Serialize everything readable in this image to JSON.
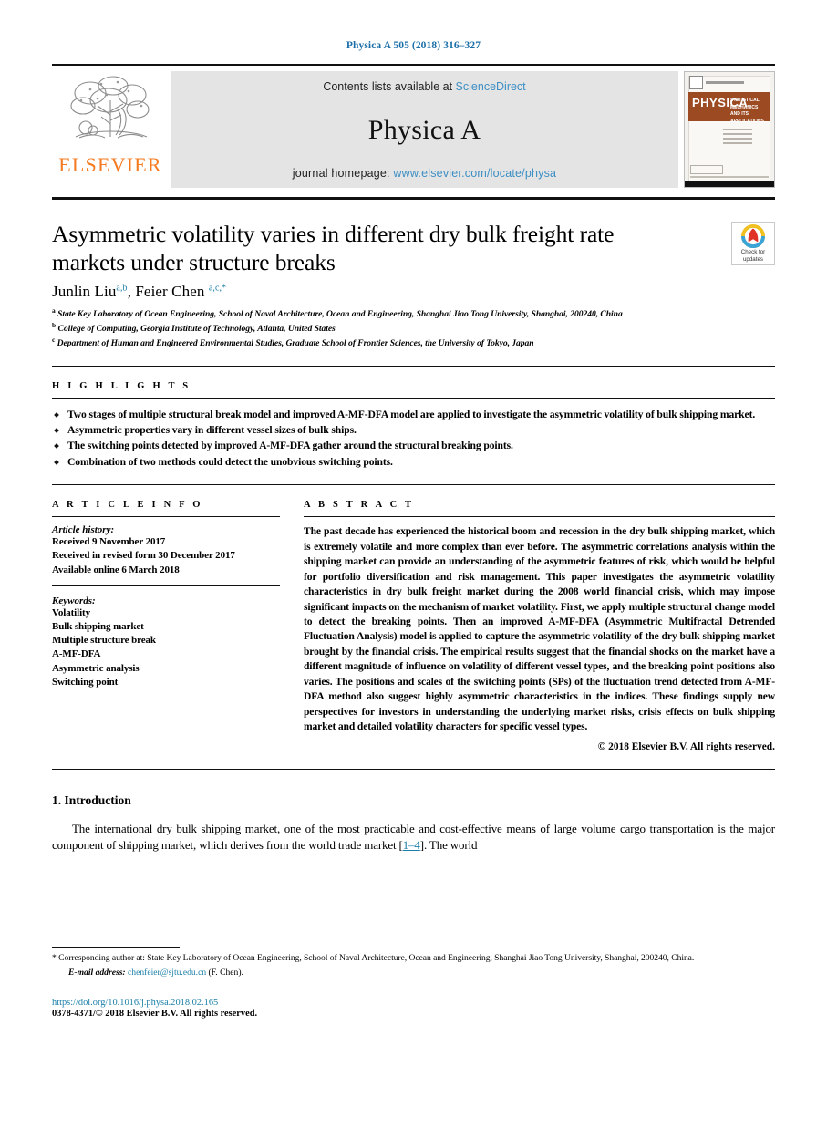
{
  "running_head": "Physica A 505 (2018) 316–327",
  "masthead": {
    "publisher_name": "ELSEVIER",
    "contents_prefix": "Contents lists available at",
    "contents_link": "ScienceDirect",
    "journal_title": "Physica A",
    "homepage_prefix": "journal homepage:",
    "homepage_link": "www.elsevier.com/locate/physa",
    "cover": {
      "wordmark": "PHYSICA",
      "subtitle": "STATISTICAL MECHANICS AND ITS APPLICATIONS"
    }
  },
  "article": {
    "title": "Asymmetric volatility varies in different dry bulk freight rate markets under structure breaks",
    "authors_plain": "Junlin Liu",
    "author1": "Junlin Liu",
    "author1_sup": "a,b",
    "author2": "Feier Chen",
    "author2_sup": "a,c,*",
    "affiliations": [
      {
        "marker": "a",
        "text": "State Key Laboratory of Ocean Engineering, School of Naval Architecture, Ocean and Engineering, Shanghai Jiao Tong University, Shanghai, 200240, China"
      },
      {
        "marker": "b",
        "text": "College of Computing, Georgia Institute of Technology, Atlanta, United States"
      },
      {
        "marker": "c",
        "text": "Department of Human and Engineered Environmental Studies, Graduate School of Frontier Sciences, the University of Tokyo, Japan"
      }
    ]
  },
  "crossmark": {
    "line1": "Check for",
    "line2": "updates"
  },
  "highlights": {
    "heading": "H I G H L I G H T S",
    "items": [
      "Two stages of multiple structural break model and improved A-MF-DFA model are applied to investigate the asymmetric volatility of bulk shipping market.",
      "Asymmetric properties vary in different vessel sizes of bulk ships.",
      "The switching points detected by improved A-MF-DFA gather around the structural breaking points.",
      "Combination of two methods could detect the unobvious switching points."
    ]
  },
  "article_info": {
    "heading": "A R T I C L E   I N F O",
    "history_label": "Article history:",
    "history": [
      "Received 9 November 2017",
      "Received in revised form 30 December 2017",
      "Available online 6 March 2018"
    ],
    "keywords_label": "Keywords:",
    "keywords": [
      "Volatility",
      "Bulk shipping market",
      "Multiple structure break",
      "A-MF-DFA",
      "Asymmetric analysis",
      "Switching point"
    ]
  },
  "abstract": {
    "heading": "A B S T R A C T",
    "body": "The past decade has experienced the historical boom and  recession in the dry bulk shipping market, which is extremely volatile and more complex than ever before. The asymmetric correlations analysis within the shipping market can provide an understanding of the asymmetric features of risk, which would be helpful for portfolio diversification and risk management. This paper investigates the asymmetric volatility characteristics in dry bulk freight market during the 2008 world financial crisis, which may impose significant impacts on the mechanism of market volatility. First, we apply multiple structural change model to detect the breaking points. Then an improved A-MF-DFA (Asymmetric Multifractal Detrended Fluctuation Analysis) model is applied to capture the asymmetric volatility of the dry bulk shipping market brought by the financial crisis. The empirical results suggest that the financial shocks on the market have a different magnitude of influence on volatility of different vessel types, and the breaking point positions also varies. The positions and scales of the switching points (SPs) of the fluctuation trend detected from A-MF-DFA method also suggest highly asymmetric characteristics in the indices. These findings supply new perspectives for investors in understanding the underlying market risks, crisis effects on bulk shipping market and detailed volatility characters for specific vessel types.",
    "copyright": "© 2018 Elsevier B.V. All rights reserved."
  },
  "introduction": {
    "heading": "1.  Introduction",
    "paragraph_part1": "The international dry bulk shipping market,  one of the most practicable and cost-effective means of large volume cargo transportation is the major component of shipping market, which derives from the world trade market [",
    "citation": "1–4",
    "paragraph_part2": "]. The world"
  },
  "footer": {
    "corresponding_star": "*",
    "corresponding_note": "Corresponding author at: State Key Laboratory of Ocean Engineering, School of Naval Architecture, Ocean and Engineering, Shanghai Jiao Tong University, Shanghai, 200240, China.",
    "email_label": "E-mail address:",
    "email": "chenfeier@sjtu.edu.cn",
    "email_owner": "(F. Chen).",
    "doi": "https://doi.org/10.1016/j.physa.2018.02.165",
    "issn": "0378-4371/© 2018 Elsevier B.V. All rights reserved."
  },
  "colors": {
    "link_blue": "#1a7fa8",
    "header_blue": "#1a6ea8",
    "elsevier_orange": "#F47B20",
    "cover_band": "#9c4a22",
    "band_gray": "#e4e4e4"
  }
}
